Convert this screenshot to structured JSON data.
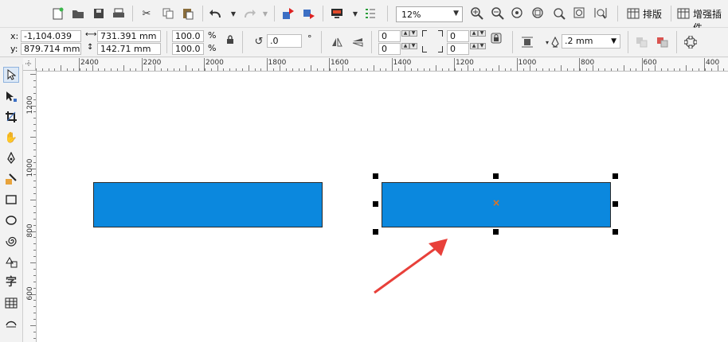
{
  "toolbar": {
    "zoom_value": "12%",
    "layout_label": "排版",
    "plugins_label": "增强插件"
  },
  "property_bar": {
    "x_label": "x:",
    "x_value": "-1,104.039 mm",
    "y_label": "y:",
    "y_value": "879.714 mm",
    "width_value": "731.391 mm",
    "height_value": "142.71 mm",
    "scale_w": "100.0",
    "scale_h": "100.0",
    "percent": "%",
    "angle_value": ".0",
    "degree": "°",
    "corner_1": "0",
    "corner_2": "0",
    "corner_3": "0",
    "corner_4": "0",
    "outline_width": ".2 mm"
  },
  "ruler_top_labels": [
    "2400",
    "2200",
    "2000",
    "1800",
    "1600",
    "1400",
    "1200",
    "1000",
    "800",
    "600",
    "400"
  ],
  "ruler_left_labels": [
    "1200",
    "1000",
    "800",
    "600"
  ],
  "toolbox": {
    "text_tool_label": "字"
  },
  "colors": {
    "rect_fill": "#0b88de",
    "center_mark": "#e8741c",
    "arrow": "#e8403a"
  }
}
